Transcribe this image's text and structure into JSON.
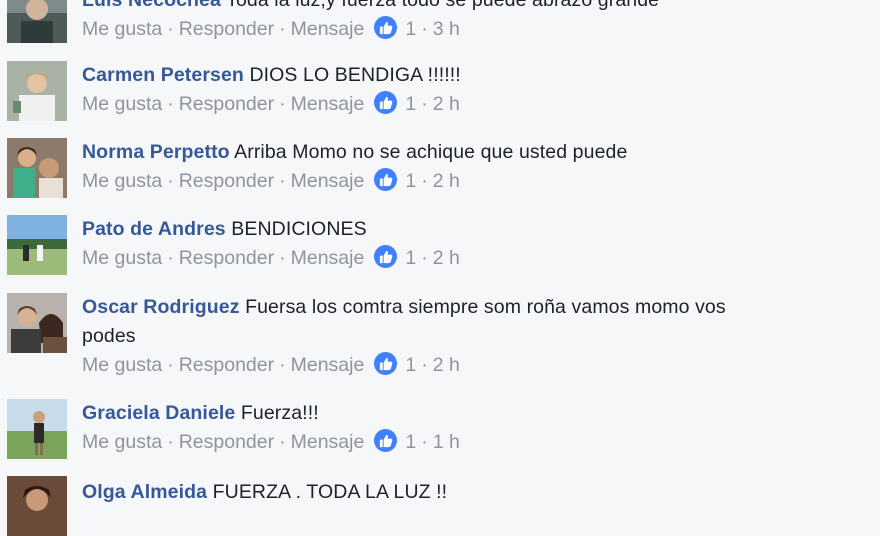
{
  "actions": {
    "like": "Me gusta",
    "reply": "Responder",
    "message": "Mensaje",
    "separator": "·"
  },
  "comments": [
    {
      "author": "Luis Necochea",
      "text": "Toda la luz,y fuerza todo se puede abrazo grande",
      "text2": "",
      "like_count": "1",
      "time": "3 h",
      "avatar_icon": "profile-photo"
    },
    {
      "author": "Carmen Petersen",
      "text": "DIOS LO BENDIGA !!!!!!",
      "text2": "",
      "like_count": "1",
      "time": "2 h",
      "avatar_icon": "profile-photo"
    },
    {
      "author": "Norma Perpetto",
      "text": "Arriba Momo no se achique que usted puede",
      "text2": "",
      "like_count": "1",
      "time": "2 h",
      "avatar_icon": "profile-photo"
    },
    {
      "author": "Pato de Andres",
      "text": "BENDICIONES",
      "text2": "",
      "like_count": "1",
      "time": "2 h",
      "avatar_icon": "profile-photo"
    },
    {
      "author": "Oscar Rodriguez",
      "text": "Fuersa los comtra siempre som roña vamos momo vos",
      "text2": "podes",
      "like_count": "1",
      "time": "2 h",
      "avatar_icon": "profile-photo"
    },
    {
      "author": "Graciela Daniele",
      "text": "Fuerza!!!",
      "text2": "",
      "like_count": "1",
      "time": "1 h",
      "avatar_icon": "profile-photo"
    },
    {
      "author": "Olga Almeida",
      "text": "FUERZA . TODA LA LUZ !!",
      "text2": "",
      "like_count": "",
      "time": "",
      "avatar_icon": "profile-photo"
    }
  ],
  "colors": {
    "author": "#365899",
    "meta": "#90949c",
    "like_badge": "#4080ff",
    "background": "#f6f7f9"
  }
}
